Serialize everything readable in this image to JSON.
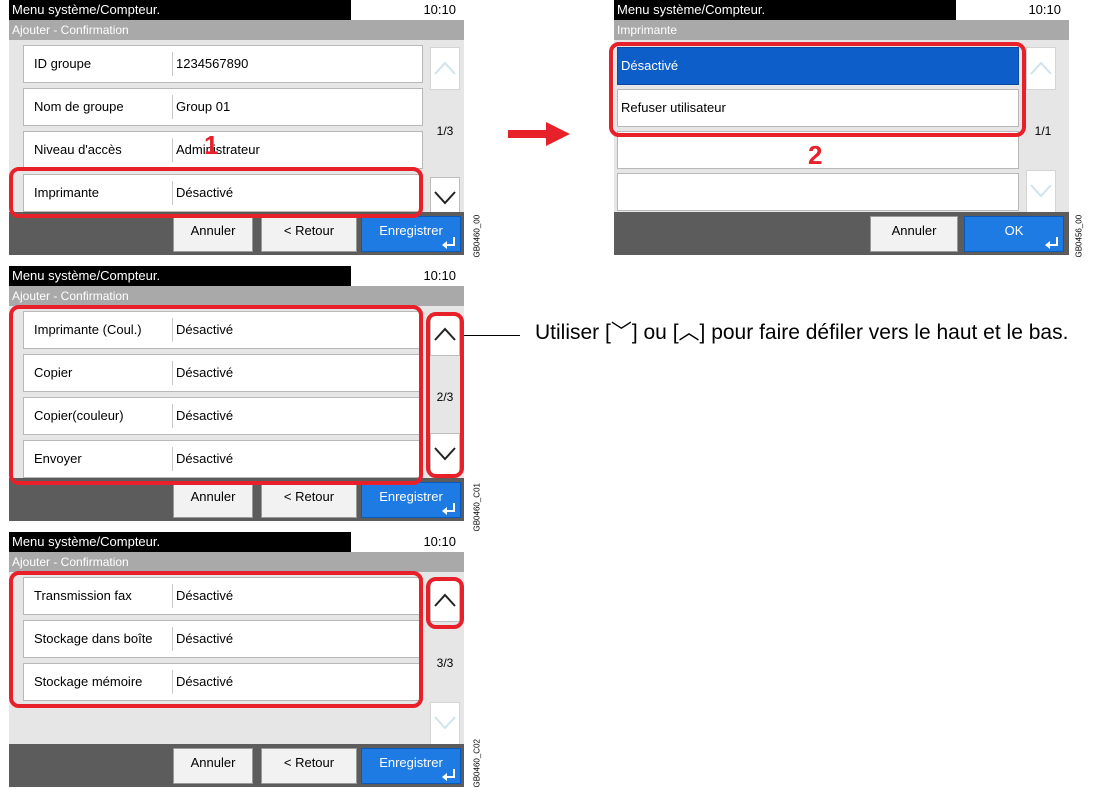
{
  "colors": {
    "highlight": "#e8202a",
    "selected_row": "#0d5ec9",
    "primary_button": "#1e7be3"
  },
  "screen1": {
    "title": "Menu système/Compteur.",
    "time": "10:10",
    "subtitle": "Ajouter - Confirmation",
    "rows": [
      {
        "label": "ID groupe",
        "value": "1234567890"
      },
      {
        "label": "Nom de groupe",
        "value": "Group 01"
      },
      {
        "label": "Niveau d'accès",
        "value": "Administrateur"
      },
      {
        "label": "Imprimante",
        "value": "Désactivé"
      }
    ],
    "page": "1/3",
    "cancel": "Annuler",
    "back": "< Retour",
    "save": "Enregistrer",
    "code": "GB0460_00"
  },
  "screen2": {
    "title": "Menu système/Compteur.",
    "time": "10:10",
    "subtitle": "Ajouter - Confirmation",
    "rows": [
      {
        "label": "Imprimante (Coul.)",
        "value": "Désactivé"
      },
      {
        "label": "Copier",
        "value": "Désactivé"
      },
      {
        "label": "Copier(couleur)",
        "value": "Désactivé"
      },
      {
        "label": "Envoyer",
        "value": "Désactivé"
      }
    ],
    "page": "2/3",
    "cancel": "Annuler",
    "back": "< Retour",
    "save": "Enregistrer",
    "code": "GB0460_C01"
  },
  "screen3": {
    "title": "Menu système/Compteur.",
    "time": "10:10",
    "subtitle": "Ajouter - Confirmation",
    "rows": [
      {
        "label": "Transmission fax",
        "value": "Désactivé"
      },
      {
        "label": "Stockage dans boîte",
        "value": "Désactivé"
      },
      {
        "label": "Stockage mémoire",
        "value": "Désactivé"
      }
    ],
    "page": "3/3",
    "cancel": "Annuler",
    "back": "< Retour",
    "save": "Enregistrer",
    "code": "GB0460_C02"
  },
  "screen4": {
    "title": "Menu système/Compteur.",
    "time": "10:10",
    "subtitle": "Imprimante",
    "options": [
      "Désactivé",
      "Refuser utilisateur"
    ],
    "selected": "Désactivé",
    "page": "1/1",
    "cancel": "Annuler",
    "ok": "OK",
    "code": "GB0456_00"
  },
  "callouts": {
    "step1": "1",
    "step2": "2"
  },
  "note": {
    "text": "Utiliser [﹀] ou [︿] pour faire défiler vers le haut et le bas."
  }
}
